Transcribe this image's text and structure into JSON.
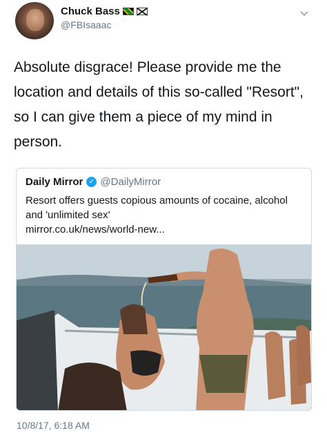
{
  "author": {
    "name": "Chuck Bass",
    "handle": "@FBIsaaac"
  },
  "tweet": {
    "text": "Absolute disgrace! Please provide me the location and details of this so-called \"Resort\", so I can give them a piece of my mind in person.",
    "timestamp": "10/8/17, 6:18 AM"
  },
  "quoted": {
    "name": "Daily Mirror",
    "handle": "@DailyMirror",
    "text": "Resort offers guests copious amounts of cocaine, alcohol and 'unlimited sex'",
    "link": "mirror.co.uk/news/world-new..."
  },
  "icons": {
    "verified": "verified-badge-icon",
    "menu": "chevron-down-icon",
    "flags": [
      "jamaica-flag-icon",
      "scotland-flag-icon"
    ]
  },
  "colors": {
    "link_blue": "#1da1f2",
    "secondary_text": "#657786",
    "border": "#cfd9de"
  }
}
